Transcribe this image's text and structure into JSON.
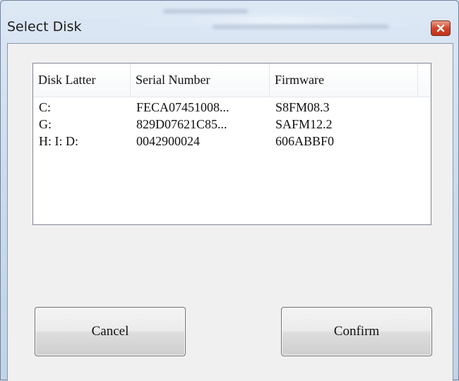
{
  "dialog": {
    "title": "Select Disk",
    "columns": [
      "Disk Latter",
      "Serial Number",
      "Firmware"
    ],
    "rows": [
      {
        "disk": "C:",
        "serial": "FECA07451008...",
        "firmware": "S8FM08.3"
      },
      {
        "disk": "G:",
        "serial": "829D07621C85...",
        "firmware": "SAFM12.2"
      },
      {
        "disk": "H: I: D:",
        "serial": "0042900024",
        "firmware": "606ABBF0"
      }
    ],
    "buttons": {
      "cancel": "Cancel",
      "confirm": "Confirm"
    }
  },
  "icons": {
    "close": "close-icon"
  },
  "colors": {
    "close_button": "#d2452b",
    "frame": "#cad9ec",
    "client": "#f0f0f0"
  }
}
